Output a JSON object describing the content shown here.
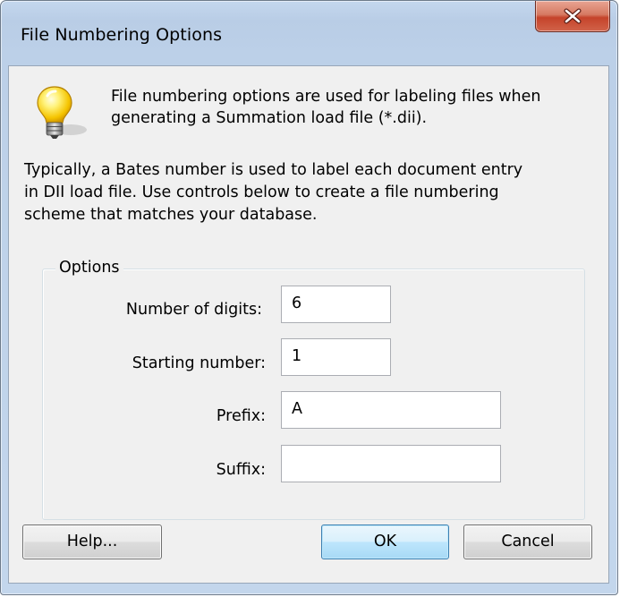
{
  "window": {
    "title": "File Numbering Options"
  },
  "info": {
    "icon": "lightbulb-icon",
    "intro_line1": "File numbering options are used for labeling files when",
    "intro_line2": "generating a Summation load file (*.dii).",
    "desc_line1": "Typically, a Bates number is used to label each document entry",
    "desc_line2": "in DII load file. Use controls below to create a file numbering",
    "desc_line3": "scheme that matches your database."
  },
  "options": {
    "legend": "Options",
    "digits_label": "Number of digits:",
    "digits_value": "6",
    "start_label": "Starting number:",
    "start_value": "1",
    "prefix_label": "Prefix:",
    "prefix_value": "A",
    "suffix_label": "Suffix:",
    "suffix_value": ""
  },
  "buttons": {
    "help": "Help...",
    "ok": "OK",
    "cancel": "Cancel"
  },
  "icons": {
    "close": "close-icon",
    "bulb": "lightbulb-icon"
  },
  "colors": {
    "close_button": "#c5432a",
    "default_button_border": "#3c7fb1",
    "dialog_background": "#f0f0f0"
  }
}
